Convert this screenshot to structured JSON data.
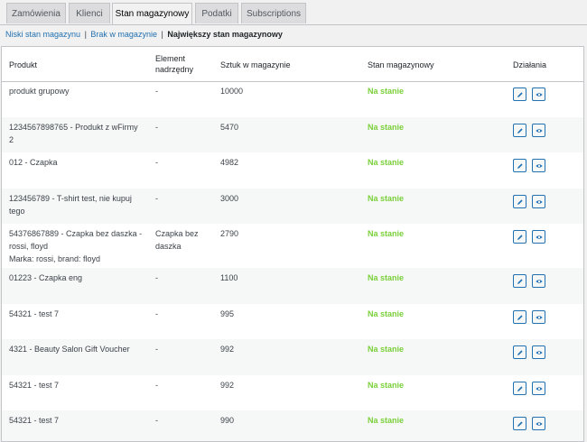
{
  "tabs": [
    {
      "label": "Zamówienia",
      "active": false
    },
    {
      "label": "Klienci",
      "active": false
    },
    {
      "label": "Stan magazynowy",
      "active": true
    },
    {
      "label": "Podatki",
      "active": false
    },
    {
      "label": "Subscriptions",
      "active": false
    }
  ],
  "subnav": {
    "low": "Niski stan magazynu",
    "out": "Brak w magazynie",
    "most": "Największy stan magazynowy",
    "separator": "|"
  },
  "table": {
    "headers": {
      "product": "Produkt",
      "parent": "Element nadrzędny",
      "qty": "Sztuk w magazynie",
      "status": "Stan magazynowy",
      "actions": "Działania"
    },
    "rows": [
      {
        "product": "produkt grupowy",
        "parent": "-",
        "qty": "10000",
        "status": "Na stanie"
      },
      {
        "product": "1234567898765 - Produkt z wFirmy 2",
        "parent": "-",
        "qty": "5470",
        "status": "Na stanie"
      },
      {
        "product": "012 - Czapka",
        "parent": "-",
        "qty": "4982",
        "status": "Na stanie"
      },
      {
        "product": "123456789 - T-shirt test, nie kupuj tego",
        "parent": "-",
        "qty": "3000",
        "status": "Na stanie"
      },
      {
        "product": "54376867889 - Czapka bez daszka - rossi, floyd",
        "meta": "Marka: rossi, brand: floyd",
        "parent": "Czapka bez daszka",
        "qty": "2790",
        "status": "Na stanie"
      },
      {
        "product": "01223 - Czapka eng",
        "parent": "-",
        "qty": "1100",
        "status": "Na stanie"
      },
      {
        "product": "54321 - test 7",
        "parent": "-",
        "qty": "995",
        "status": "Na stanie"
      },
      {
        "product": "4321 - Beauty Salon Gift Voucher",
        "parent": "-",
        "qty": "992",
        "status": "Na stanie"
      },
      {
        "product": "54321 - test 7",
        "parent": "-",
        "qty": "992",
        "status": "Na stanie"
      },
      {
        "product": "54321 - test 7",
        "parent": "-",
        "qty": "990",
        "status": "Na stanie"
      }
    ]
  },
  "icons": {
    "edit": "pencil-icon",
    "view": "eye-icon"
  },
  "colors": {
    "accent": "#2271b1",
    "in_stock": "#7ad03a"
  }
}
